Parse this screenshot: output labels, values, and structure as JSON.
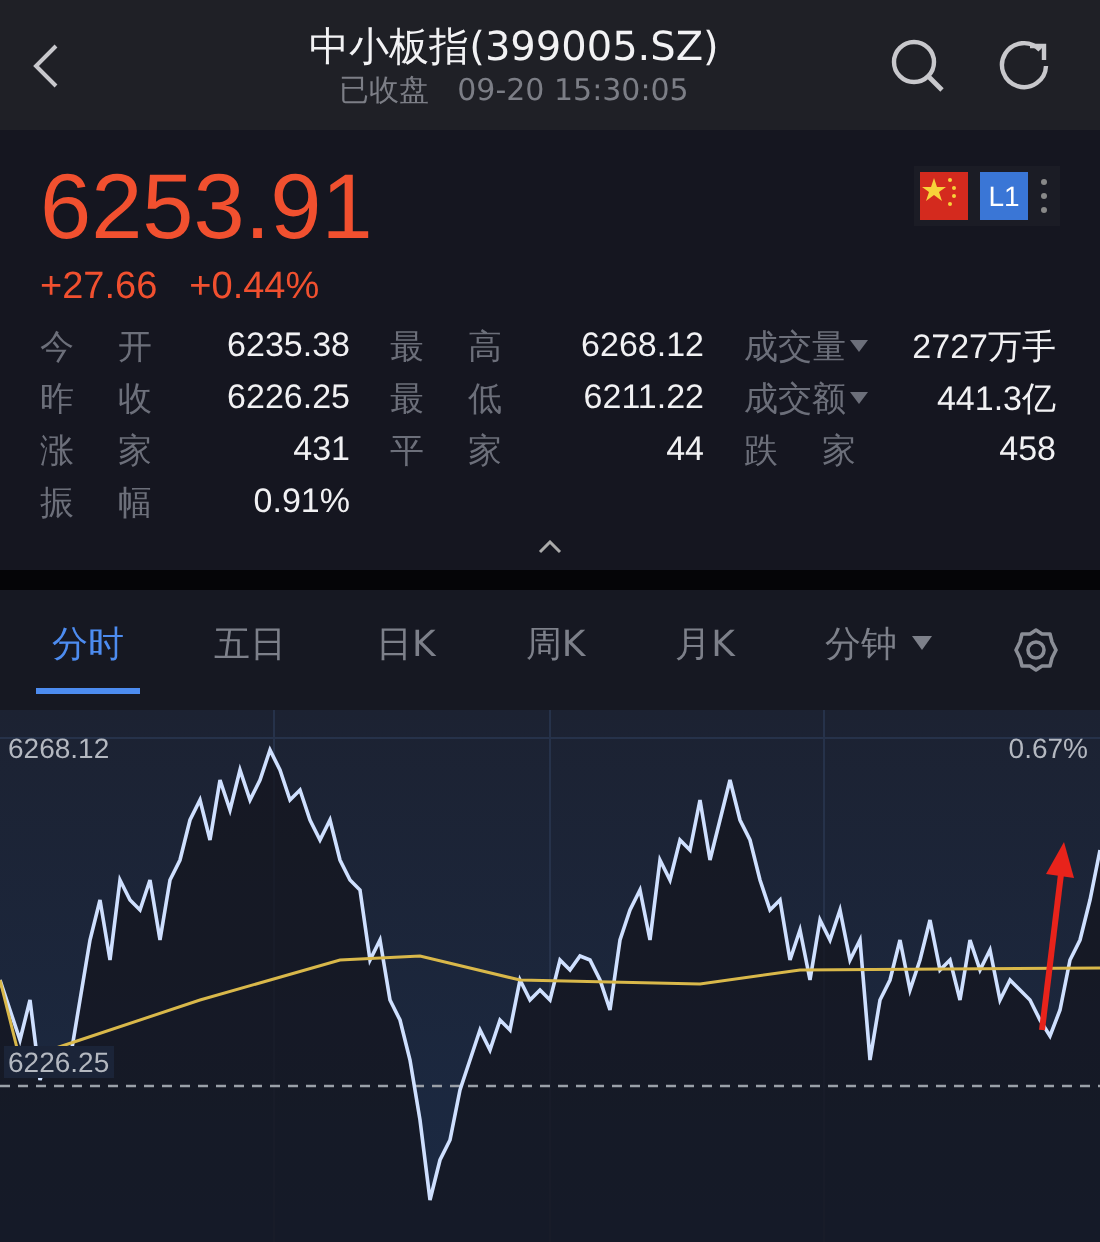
{
  "header": {
    "title": "中小板指(399005.SZ)",
    "status": "已收盘",
    "time": "09-20 15:30:05"
  },
  "quote": {
    "price": "6253.91",
    "change": "+27.66",
    "change_percent": "+0.44%",
    "level_badge": "L1"
  },
  "stats": [
    {
      "label": "今开",
      "value": "6235.38",
      "dropdown": false
    },
    {
      "label": "最高",
      "value": "6268.12",
      "dropdown": false
    },
    {
      "label": "成交量",
      "value": "2727万手",
      "dropdown": true
    },
    {
      "label": "昨收",
      "value": "6226.25",
      "dropdown": false
    },
    {
      "label": "最低",
      "value": "6211.22",
      "dropdown": false
    },
    {
      "label": "成交额",
      "value": "441.3亿",
      "dropdown": true
    },
    {
      "label": "涨家",
      "value": "431",
      "dropdown": false
    },
    {
      "label": "平家",
      "value": "44",
      "dropdown": false
    },
    {
      "label": "跌家",
      "value": "458",
      "dropdown": false
    },
    {
      "label": "振幅",
      "value": "0.91%",
      "dropdown": false
    }
  ],
  "tabs": [
    {
      "label": "分时",
      "selected": true,
      "dropdown": false
    },
    {
      "label": "五日",
      "selected": false,
      "dropdown": false
    },
    {
      "label": "日K",
      "selected": false,
      "dropdown": false
    },
    {
      "label": "周K",
      "selected": false,
      "dropdown": false
    },
    {
      "label": "月K",
      "selected": false,
      "dropdown": false
    },
    {
      "label": "分钟",
      "selected": false,
      "dropdown": true
    }
  ],
  "chart": {
    "high_label": "6268.12",
    "high_percent": "0.67%",
    "base_label": "6226.25"
  }
}
